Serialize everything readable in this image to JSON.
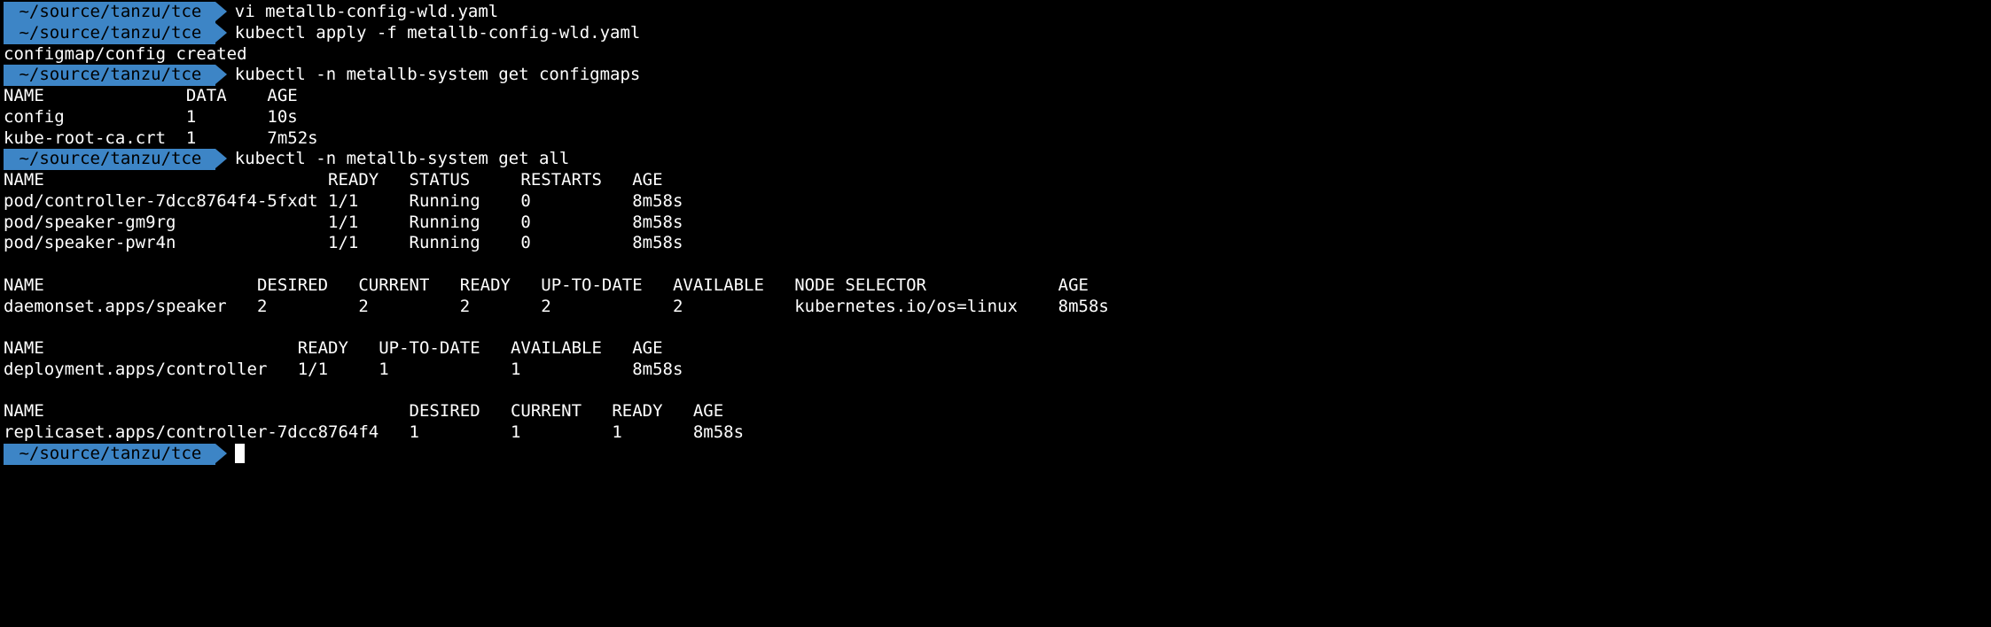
{
  "prompt_path": "~/source/tanzu/tce",
  "blocks": [
    {
      "type": "cmd",
      "text": "vi metallb-config-wld.yaml"
    },
    {
      "type": "cmd",
      "text": "kubectl apply -f metallb-config-wld.yaml"
    },
    {
      "type": "out",
      "text": "configmap/config created"
    },
    {
      "type": "cmd",
      "text": "kubectl -n metallb-system get configmaps"
    },
    {
      "type": "table",
      "cols": [
        18,
        8,
        8
      ],
      "rows": [
        [
          "NAME",
          "DATA",
          "AGE"
        ],
        [
          "config",
          "1",
          "10s"
        ],
        [
          "kube-root-ca.crt",
          "1",
          "7m52s"
        ]
      ]
    },
    {
      "type": "cmd",
      "text": "kubectl -n metallb-system get all"
    },
    {
      "type": "table",
      "cols": [
        32,
        8,
        11,
        11,
        8
      ],
      "rows": [
        [
          "NAME",
          "READY",
          "STATUS",
          "RESTARTS",
          "AGE"
        ],
        [
          "pod/controller-7dcc8764f4-5fxdt",
          "1/1",
          "Running",
          "0",
          "8m58s"
        ],
        [
          "pod/speaker-gm9rg",
          "1/1",
          "Running",
          "0",
          "8m58s"
        ],
        [
          "pod/speaker-pwr4n",
          "1/1",
          "Running",
          "0",
          "8m58s"
        ]
      ]
    },
    {
      "type": "blank"
    },
    {
      "type": "table",
      "cols": [
        25,
        10,
        10,
        8,
        13,
        12,
        26,
        8
      ],
      "rows": [
        [
          "NAME",
          "DESIRED",
          "CURRENT",
          "READY",
          "UP-TO-DATE",
          "AVAILABLE",
          "NODE SELECTOR",
          "AGE"
        ],
        [
          "daemonset.apps/speaker",
          "2",
          "2",
          "2",
          "2",
          "2",
          "kubernetes.io/os=linux",
          "8m58s"
        ]
      ]
    },
    {
      "type": "blank"
    },
    {
      "type": "table",
      "cols": [
        29,
        8,
        13,
        12,
        8
      ],
      "rows": [
        [
          "NAME",
          "READY",
          "UP-TO-DATE",
          "AVAILABLE",
          "AGE"
        ],
        [
          "deployment.apps/controller",
          "1/1",
          "1",
          "1",
          "8m58s"
        ]
      ]
    },
    {
      "type": "blank"
    },
    {
      "type": "table",
      "cols": [
        40,
        10,
        10,
        8,
        8
      ],
      "rows": [
        [
          "NAME",
          "DESIRED",
          "CURRENT",
          "READY",
          "AGE"
        ],
        [
          "replicaset.apps/controller-7dcc8764f4",
          "1",
          "1",
          "1",
          "8m58s"
        ]
      ]
    },
    {
      "type": "cursor"
    }
  ]
}
